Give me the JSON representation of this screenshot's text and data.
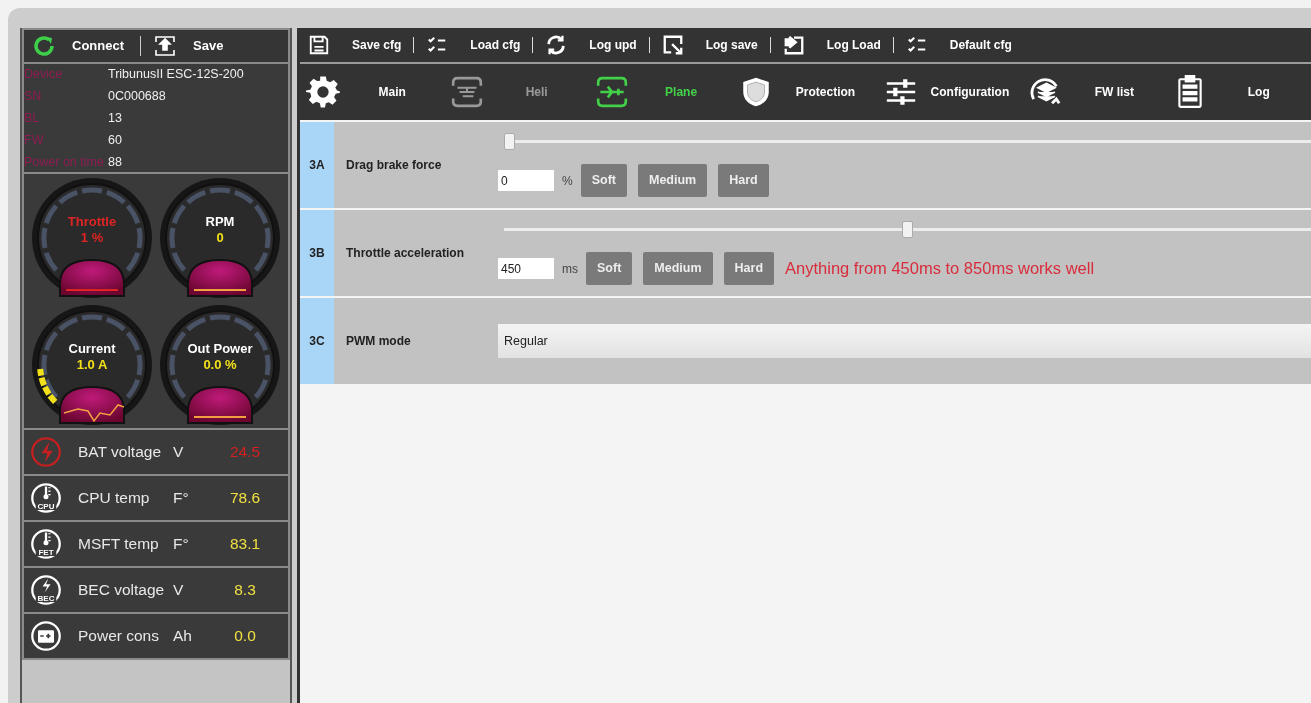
{
  "left_toolbar": [
    {
      "label": "Connect"
    },
    {
      "label": "Save"
    }
  ],
  "device_info": [
    {
      "label": "Device",
      "value": "TribunusII ESC-12S-200"
    },
    {
      "label": "SN",
      "value": "0C000688"
    },
    {
      "label": "BL",
      "value": "13"
    },
    {
      "label": "FW",
      "value": "60"
    },
    {
      "label": "Power on time",
      "value": "88"
    }
  ],
  "gauges": [
    {
      "label": "Throttle",
      "value": "1 %",
      "alert": true
    },
    {
      "label": "RPM",
      "value": "0",
      "alert": false
    },
    {
      "label": "Current",
      "value": "1.0 A",
      "alert": false
    },
    {
      "label": "Out Power",
      "value": "0.0 %",
      "alert": false
    }
  ],
  "stats": [
    {
      "label": "BAT voltage",
      "unit": "V",
      "value": "24.5",
      "alert": true
    },
    {
      "badge": "CPU",
      "label": "CPU temp",
      "unit": "F°",
      "value": "78.6",
      "alert": false
    },
    {
      "badge": "FET",
      "label": "MSFT temp",
      "unit": "F°",
      "value": "83.1",
      "alert": false
    },
    {
      "badge": "BEC",
      "label": "BEC voltage",
      "unit": "V",
      "value": "8.3",
      "alert": false
    },
    {
      "label": "Power cons",
      "unit": "Ah",
      "value": "0.0",
      "alert": false
    }
  ],
  "toolbar": [
    {
      "label": "Save cfg"
    },
    {
      "label": "Load cfg"
    },
    {
      "label": "Log upd"
    },
    {
      "label": "Log save"
    },
    {
      "label": "Log Load"
    },
    {
      "label": "Default cfg"
    }
  ],
  "tabs": [
    {
      "label": "Main",
      "selected": false,
      "disabled": false
    },
    {
      "label": "Heli",
      "selected": false,
      "disabled": true
    },
    {
      "label": "Plane",
      "selected": true,
      "disabled": false
    },
    {
      "label": "Protection",
      "selected": false,
      "disabled": false
    },
    {
      "label": "Configuration",
      "selected": false,
      "disabled": false
    },
    {
      "label": "FW list",
      "selected": false,
      "disabled": false
    },
    {
      "label": "Log",
      "selected": false,
      "disabled": false
    }
  ],
  "settings": [
    {
      "kind": "slider",
      "code": "3A",
      "name": "Drag brake force",
      "level": 0,
      "value": "0",
      "unit": "%",
      "presets": [
        "Soft",
        "Medium",
        "Hard"
      ]
    },
    {
      "kind": "slider",
      "code": "3B",
      "name": "Throttle acceleration",
      "level": 0.5,
      "value": "450",
      "unit": "ms",
      "presets": [
        "Soft",
        "Medium",
        "Hard"
      ],
      "note": "Anything from 450ms to 850ms works well"
    },
    {
      "kind": "select",
      "code": "3C",
      "name": "PWM mode",
      "value": "Regular"
    }
  ]
}
